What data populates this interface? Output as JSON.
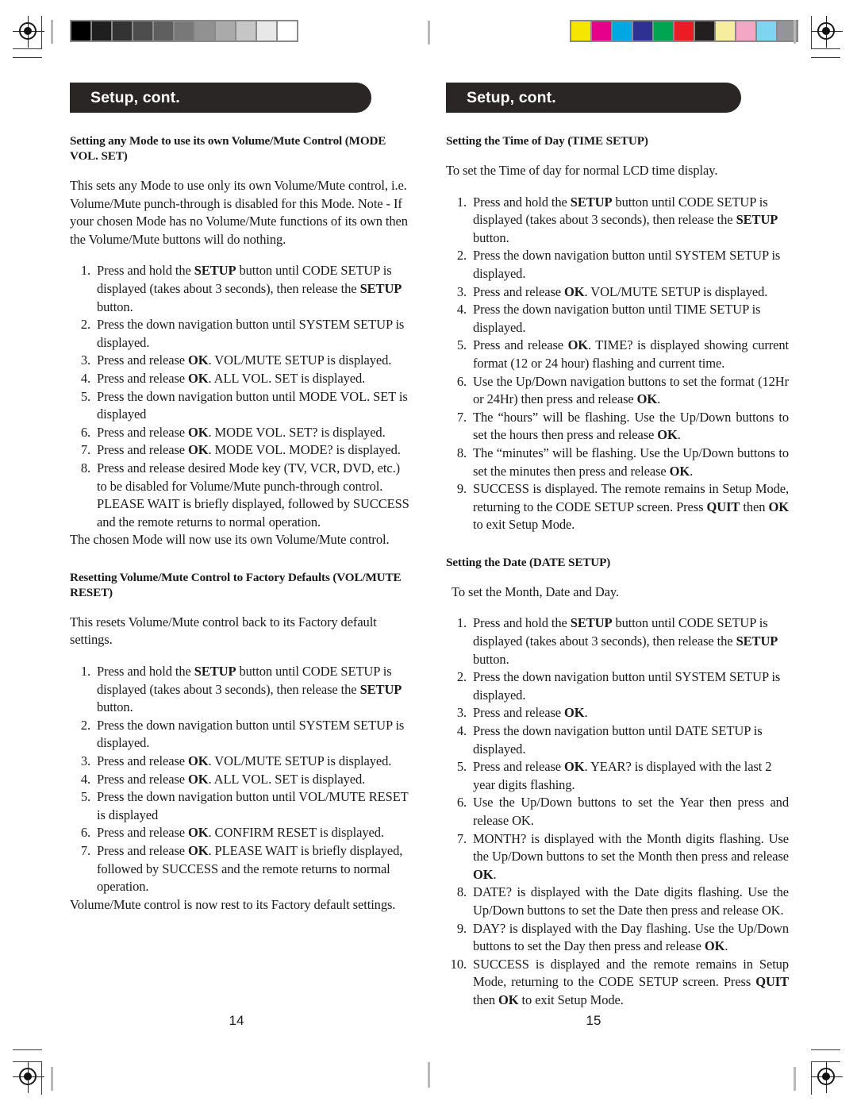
{
  "document": {
    "type": "scanned-manual-spread",
    "banner_color": "#2b2626",
    "banner_text_color": "#ffffff"
  },
  "calibration": {
    "grayscale_wedge": {
      "name": "grayscale-step-wedge",
      "patches": [
        "#000000",
        "#1f1f1f",
        "#333333",
        "#4d4d4d",
        "#5f5f5f",
        "#787878",
        "#919191",
        "#aaaaaa",
        "#c6c6c6",
        "#e8e8e8",
        "#ffffff"
      ]
    },
    "color_bar": {
      "name": "cmyk-color-control-bar",
      "patches": [
        "#f5e500",
        "#e6008c",
        "#00a7e1",
        "#2e3192",
        "#00a551",
        "#ed1c24",
        "#231f20",
        "#f7eda0",
        "#f4a7c4",
        "#7fd4f2",
        "#939598"
      ]
    }
  },
  "left_page": {
    "banner_title": "Setup, cont.",
    "folio": "14",
    "sections": [
      {
        "heading": "Setting any Mode to use its own Volume/Mute Control (MODE VOL. SET)",
        "intro": "This sets any Mode to use only its own Volume/Mute control, i.e. Volume/Mute punch-through is disabled for this Mode.  Note - If your chosen Mode has no Volume/Mute functions of its own then the Volume/Mute buttons will do nothing.",
        "steps": [
          "Press and hold the <b>SETUP</b> button until CODE SETUP is displayed (takes about 3 seconds), then release the <b>SETUP</b> button.",
          "Press the down navigation button until SYSTEM SETUP is displayed.",
          "Press and release <b>OK</b>.  VOL/MUTE SETUP is displayed.",
          "Press and release <b>OK</b>.  ALL VOL. SET is displayed.",
          "Press the down navigation button until MODE VOL. SET is displayed",
          "Press and release <b>OK</b>.  MODE VOL. SET? is displayed.",
          "Press and release <b>OK</b>.  MODE VOL. MODE? is displayed.",
          "Press and release desired Mode key (TV, VCR, DVD, etc.) to be disabled for Volume/Mute punch-through control. PLEASE WAIT is briefly displayed, followed by SUCCESS and the remote returns to normal operation."
        ],
        "outro": "The chosen Mode will now use its own Volume/Mute control."
      },
      {
        "heading": "Resetting Volume/Mute Control to Factory Defaults (VOL/MUTE RESET)",
        "intro": "This resets Volume/Mute control back to its Factory default settings.",
        "steps": [
          "Press and hold the <b>SETUP</b> button until CODE SETUP is displayed (takes about 3 seconds), then release the <b>SETUP</b> button.",
          "Press the down navigation button until SYSTEM SETUP is displayed.",
          "Press and release <b>OK</b>.  VOL/MUTE SETUP is displayed.",
          "Press and release <b>OK</b>.  ALL VOL. SET is displayed.",
          "Press the down navigation button until VOL/MUTE RESET is displayed",
          "Press and release <b>OK</b>.  CONFIRM RESET is displayed.",
          "Press and release <b>OK</b>.  PLEASE WAIT is briefly displayed, followed by SUCCESS and the remote returns to normal operation."
        ],
        "outro": "Volume/Mute control is now rest to its Factory default settings."
      }
    ]
  },
  "right_page": {
    "banner_title": "Setup, cont.",
    "folio": "15",
    "sections": [
      {
        "heading": "Setting the Time of Day (TIME SETUP)",
        "intro": "To set the Time of day for normal LCD time display.",
        "steps": [
          "Press and hold the <b>SETUP</b> button until CODE SETUP is displayed (takes about 3 seconds), then release the <b>SETUP</b> button.",
          "Press the down navigation button until SYSTEM SETUP is displayed.",
          "Press and release <b>OK</b>.  VOL/MUTE SETUP is displayed.",
          "Press the down navigation button until TIME SETUP is displayed.",
          "Press and release <b>OK</b>.  TIME? is displayed showing current format (12 or 24 hour) flashing and current time.",
          "Use the Up/Down navigation buttons to set the format (12Hr or 24Hr) then press and release <b>OK</b>.",
          "The &ldquo;hours&rdquo; will be flashing.  Use the Up/Down buttons to set the hours then press and release <b>OK</b>.",
          "The &ldquo;minutes&rdquo; will be flashing.  Use the Up/Down buttons to set the minutes then press and release <b>OK</b>.",
          "SUCCESS is displayed. The remote remains in Setup Mode, returning to the CODE SETUP screen. Press <b>QUIT</b> then <b>OK</b> to exit Setup Mode."
        ],
        "outro": ""
      },
      {
        "heading": "Setting the Date (DATE SETUP)",
        "intro": "To set the Month, Date and Day.",
        "steps": [
          "Press and hold the <b>SETUP</b> button until CODE SETUP is displayed (takes about 3 seconds), then release the <b>SETUP</b> button.",
          "Press the down navigation button until SYSTEM SETUP is displayed.",
          "Press and release <b>OK</b>.",
          "Press the down navigation button until DATE SETUP is displayed.",
          "Press and release <b>OK</b>. YEAR? is displayed with the last 2 year digits flashing.",
          "Use the Up/Down buttons to set the Year then press and release OK.",
          "MONTH? is displayed with the Month digits flashing. Use the Up/Down buttons to set the Month then press and release <b>OK</b>.",
          "DATE? is displayed with the Date digits flashing.  Use the Up/Down buttons to set the Date then press and release OK.",
          "DAY? is displayed with the Day flashing.  Use the Up/Down buttons to set the Day then press and release <b>OK</b>.",
          "SUCCESS is displayed and the remote remains in Setup Mode, returning to the CODE SETUP screen. Press <b>QUIT</b> then <b>OK</b> to exit Setup Mode."
        ],
        "outro": ""
      }
    ]
  }
}
